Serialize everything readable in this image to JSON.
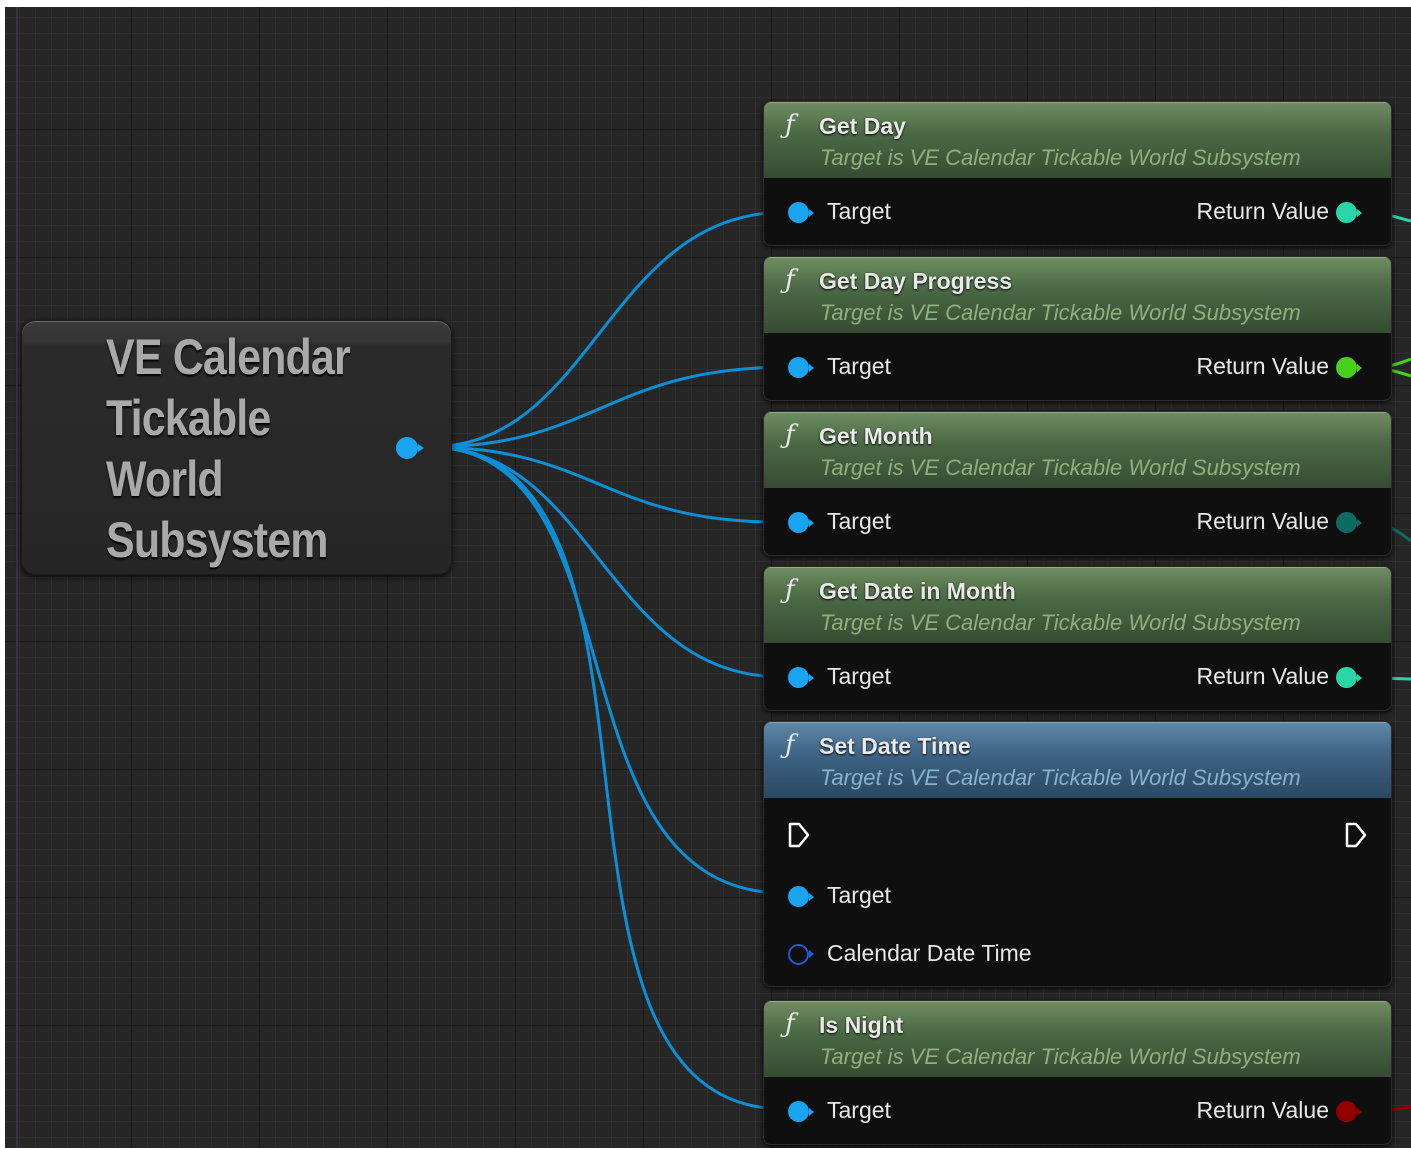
{
  "variable_node": {
    "title": "VE Calendar Tickable World Subsystem",
    "pin_color": "#1aa3ee"
  },
  "nodes": [
    {
      "title": "Get Day",
      "subtitle": "Target is VE Calendar Tickable World Subsystem",
      "input_label": "Target",
      "output_label": "Return Value",
      "output_color": "#2ad6a8"
    },
    {
      "title": "Get Day Progress",
      "subtitle": "Target is VE Calendar Tickable World Subsystem",
      "input_label": "Target",
      "output_label": "Return Value",
      "output_color": "#48d01c"
    },
    {
      "title": "Get Month",
      "subtitle": "Target is VE Calendar Tickable World Subsystem",
      "input_label": "Target",
      "output_label": "Return Value",
      "output_color": "#0d6b63"
    },
    {
      "title": "Get Date in Month",
      "subtitle": "Target is VE Calendar Tickable World Subsystem",
      "input_label": "Target",
      "output_label": "Return Value",
      "output_color": "#2ad6a8"
    },
    {
      "title": "Set Date Time",
      "subtitle": "Target is VE Calendar Tickable World Subsystem",
      "input_label": "Target",
      "input2_label": "Calendar Date Time"
    },
    {
      "title": "Is Night",
      "subtitle": "Target is VE Calendar Tickable World Subsystem",
      "input_label": "Target",
      "output_label": "Return Value",
      "output_color": "#930000"
    }
  ],
  "function_icon": "ƒ",
  "wire_color": "#1aa3ee"
}
